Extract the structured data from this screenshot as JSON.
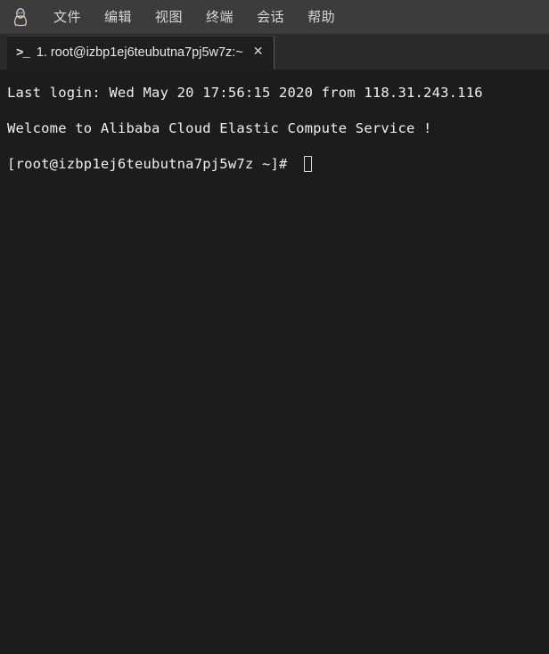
{
  "window": {
    "app_icon": "tux-penguin-icon"
  },
  "menubar": {
    "items": [
      {
        "label": "文件",
        "name": "menu-file"
      },
      {
        "label": "编辑",
        "name": "menu-edit"
      },
      {
        "label": "视图",
        "name": "menu-view"
      },
      {
        "label": "终端",
        "name": "menu-terminal"
      },
      {
        "label": "会话",
        "name": "menu-session"
      },
      {
        "label": "帮助",
        "name": "menu-help"
      }
    ]
  },
  "tabstrip": {
    "tabs": [
      {
        "prompt_icon": ">_",
        "label": "1. root@izbp1ej6teubutna7pj5w7z:~",
        "close_label": "✕",
        "active": true
      }
    ]
  },
  "terminal": {
    "lines": [
      "Last login: Wed May 20 17:56:15 2020 from 118.31.243.116",
      "Welcome to Alibaba Cloud Elastic Compute Service !"
    ],
    "prompt": "[root@izbp1ej6teubutna7pj5w7z ~]# ",
    "cursor": "block-outline-cursor"
  },
  "colors": {
    "menubar_bg": "#3c3c3c",
    "tabstrip_bg": "#2b2b2b",
    "tab_active_bg": "#1e1e1e",
    "terminal_bg": "#1c1c1c",
    "terminal_fg": "#f0f0f0",
    "menu_fg": "#d6d6d6"
  }
}
